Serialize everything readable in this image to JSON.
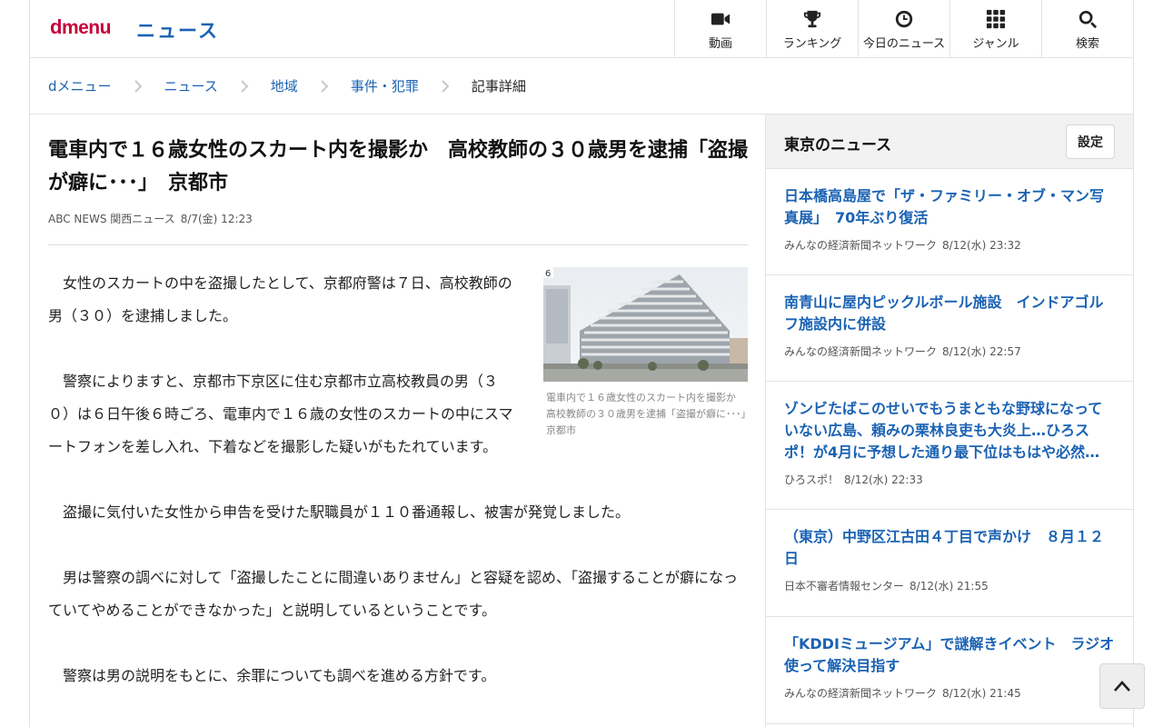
{
  "header": {
    "logo_d": "d",
    "logo_menu": "menu",
    "section": "ニュース",
    "nav": [
      {
        "label": "動画",
        "icon": "video-camera-icon"
      },
      {
        "label": "ランキング",
        "icon": "trophy-icon"
      },
      {
        "label": "今日のニュース",
        "icon": "clock-icon"
      },
      {
        "label": "ジャンル",
        "icon": "grid-icon"
      },
      {
        "label": "検索",
        "icon": "search-icon"
      }
    ]
  },
  "breadcrumb": [
    "dメニュー",
    "ニュース",
    "地域",
    "事件・犯罪",
    "記事詳細"
  ],
  "article": {
    "title": "電車内で１６歳女性のスカート内を撮影か　高校教師の３０歳男を逮捕「盗撮が癖に･･･」　京都市",
    "source": "ABC NEWS 関西ニュース",
    "datetime": "8/7(金) 12:23",
    "photo_badge": "6",
    "caption": "電車内で１６歳女性のスカート内を撮影か　高校教師の３０歳男を逮捕「盗撮が癖に･･･」　京都市",
    "paragraphs": [
      "　女性のスカートの中を盗撮したとして、京都府警は７日、高校教師の男（３０）を逮捕しました。",
      "　警察によりますと、京都市下京区に住む京都市立高校教員の男（３０）は６日午後６時ごろ、電車内で１６歳の女性のスカートの中にスマートフォンを差し入れ、下着などを撮影した疑いがもたれています。",
      "　盗撮に気付いた女性から申告を受けた駅職員が１１０番通報し、被害が発覚しました。",
      "　男は警察の調べに対して「盗撮したことに間違いありません」と容疑を認め、「盗撮することが癖になっていてやめることができなかった」と説明しているということです。",
      "　警察は男の説明をもとに、余罪についても調べを進める方針です。"
    ]
  },
  "sidebar": {
    "title": "東京のニュース",
    "settings_label": "設定",
    "items": [
      {
        "title": "日本橋高島屋で「ザ・ファミリー・オブ・マン写真展」　70年ぶり復活",
        "source": "みんなの経済新聞ネットワーク",
        "datetime": "8/12(水) 23:32"
      },
      {
        "title": "南青山に屋内ピックルボール施設　インドアゴルフ施設内に併設",
        "source": "みんなの経済新聞ネットワーク",
        "datetime": "8/12(水) 22:57"
      },
      {
        "title": "ゾンビたばこのせいでもうまともな野球になっていない広島、頼みの栗林良吏も大炎上…ひろスポ！が4月に予想した通り最下位はもはや必然…",
        "source": "ひろスポ！",
        "datetime": "8/12(水) 22:33"
      },
      {
        "title": "（東京）中野区江古田４丁目で声かけ　８月１２日",
        "source": "日本不審者情報センター",
        "datetime": "8/12(水) 21:55"
      },
      {
        "title": "「KDDIミュージアム」で謎解きイベント　ラジオ使って解決目指す",
        "source": "みんなの経済新聞ネットワーク",
        "datetime": "8/12(水) 21:45"
      }
    ]
  }
}
